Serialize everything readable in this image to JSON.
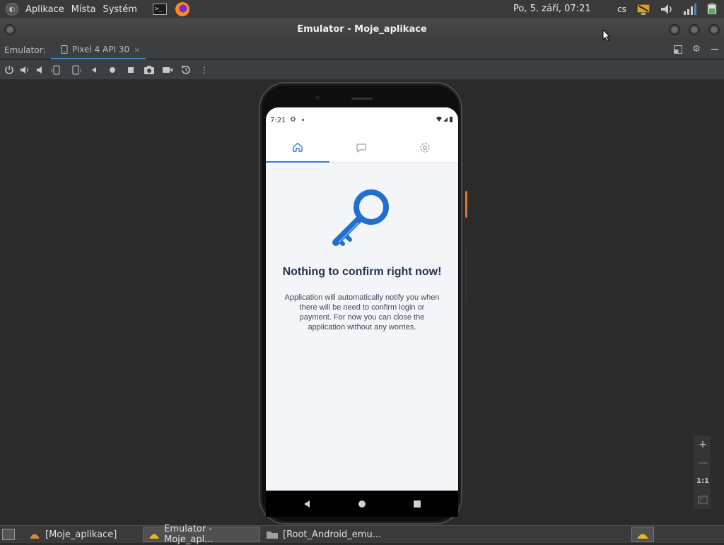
{
  "top_panel": {
    "menus": [
      "Aplikace",
      "Místa",
      "Systém"
    ],
    "clock": "Po,  5. září, 07:21",
    "language": "cs",
    "icons": [
      "menu-logo-icon",
      "terminal-icon",
      "firefox-icon",
      "display-icon",
      "volume-icon",
      "network-signal-icon",
      "battery-power-icon"
    ]
  },
  "window": {
    "title": "Emulator - Moje_aplikace"
  },
  "emulator_tabbar": {
    "label": "Emulator:",
    "device_tab": "Pixel 4 API 30",
    "close": "×"
  },
  "toolbar": {
    "icons": [
      "power-icon",
      "volume-up-icon",
      "volume-down-icon",
      "rotate-left-icon",
      "rotate-right-icon",
      "back-icon",
      "home-icon",
      "overview-icon",
      "screenshot-icon",
      "screen-record-icon",
      "snapshot-icon",
      "more-icon"
    ]
  },
  "phone": {
    "status_time": "7:21",
    "app_tabs": [
      "home-icon",
      "messages-icon",
      "settings-icon"
    ],
    "empty_state": {
      "title": "Nothing to confirm right now!",
      "text": "Application will automatically notify you when there will be need to confirm login or payment. For now you can close the application without any worries."
    },
    "accent_color": "#2c7be5"
  },
  "zoom_controls": {
    "zoom_in": "+",
    "zoom_out": "—",
    "actual_size": "1:1"
  },
  "taskbar": {
    "items": [
      {
        "label": "[Moje_aplikace]",
        "active": false
      },
      {
        "label": "Emulator - Moje_apl...",
        "active": true
      },
      {
        "label": "[Root_Android_emu...",
        "active": false
      }
    ]
  }
}
